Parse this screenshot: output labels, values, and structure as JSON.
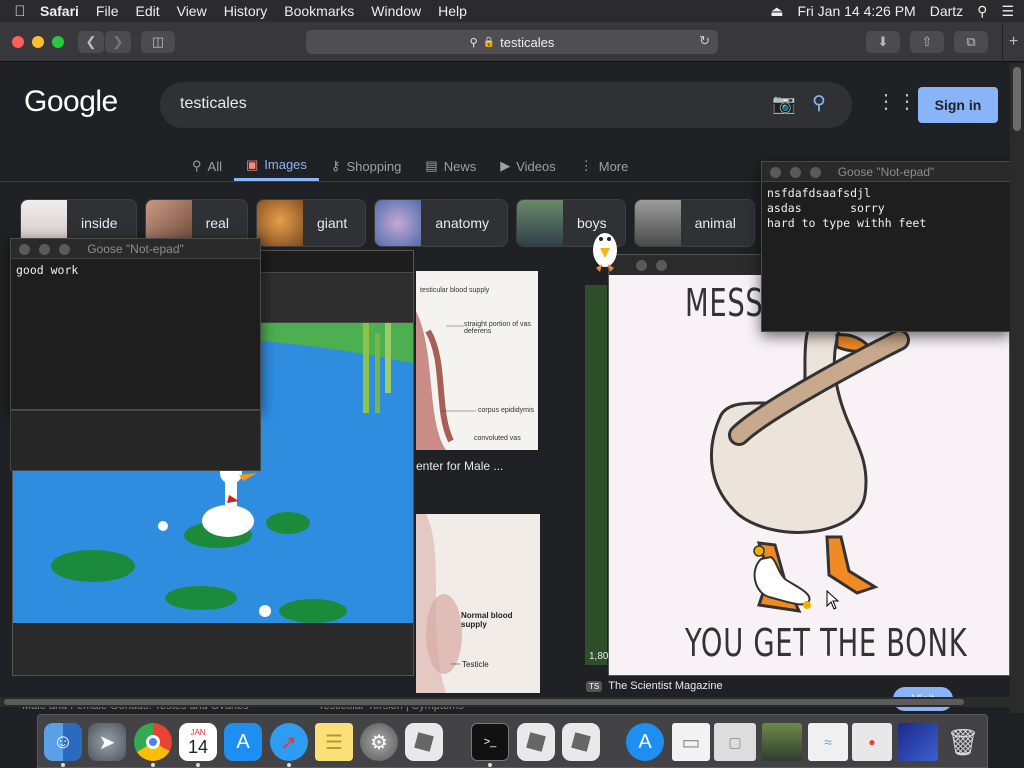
{
  "menubar": {
    "apple": "",
    "items": [
      "Safari",
      "File",
      "Edit",
      "View",
      "History",
      "Bookmarks",
      "Window",
      "Help"
    ],
    "datetime": "Fri Jan 14  4:26 PM",
    "user": "Dartz"
  },
  "browser": {
    "url": "testicales",
    "lock_glyph": "🔒"
  },
  "google": {
    "logo": "Google",
    "query": "testicales",
    "signin": "Sign in",
    "tabs": [
      {
        "label": "All",
        "icon": "search-icon"
      },
      {
        "label": "Images",
        "icon": "image-icon",
        "active": true
      },
      {
        "label": "Shopping",
        "icon": "tag-icon"
      },
      {
        "label": "News",
        "icon": "news-icon"
      },
      {
        "label": "Videos",
        "icon": "play-icon"
      },
      {
        "label": "More",
        "icon": "dots-vertical-icon"
      }
    ],
    "chips": [
      "inside",
      "real",
      "giant",
      "anatomy",
      "boys",
      "animal"
    ],
    "results": {
      "blood_supply_labels": [
        "testicular blood supply",
        "straight portion of vas deferens",
        "corpus epididymis",
        "convoluted vas"
      ],
      "caption_center": "enter for Male ...",
      "normal_labels": [
        "Normal blood supply",
        "Testicle"
      ],
      "bottom_left": "Male and Female Gonads: Testes and Ovaries",
      "bottom_mid": "Testicular Torsion | Symptoms",
      "scientist_badge": "TS",
      "scientist_source": "The Scientist Magazine",
      "number_left": "1,80",
      "visit": "Visit"
    }
  },
  "goose_notes": [
    {
      "title": "Goose \"Not-epad\"",
      "text": "good work"
    },
    {
      "title": "Goose \"Not-epad\"",
      "text": "nsfdafdsaafsdjl\nasdas       sorry\nhard to type withh feet"
    }
  ],
  "meme": {
    "top_text": "MESS W",
    "bottom_text": "YOU GET THE BONK"
  },
  "dock": {
    "calendar_month": "JAN",
    "calendar_day": "14",
    "terminal_prompt": ">_"
  },
  "colors": {
    "accent": "#8ab4f8",
    "page_bg": "#202124",
    "pond": "#2f8de0"
  }
}
